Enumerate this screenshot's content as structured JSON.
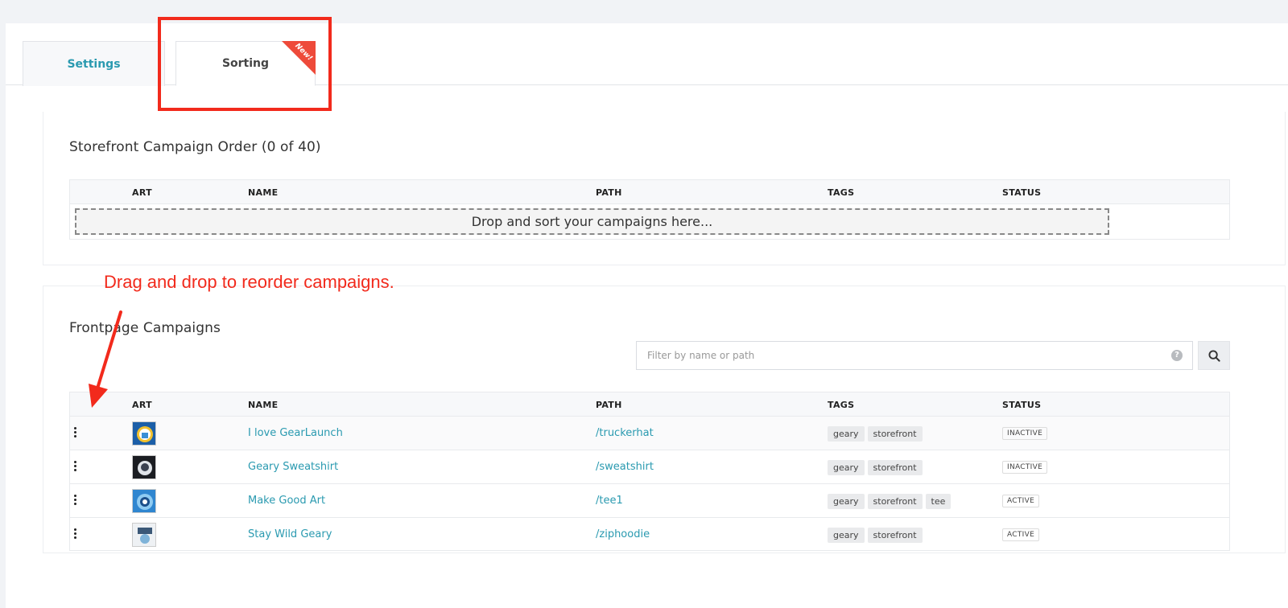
{
  "tabs": [
    {
      "label": "Settings"
    },
    {
      "label": "Sorting",
      "badge": "New!"
    }
  ],
  "storefront": {
    "title": "Storefront Campaign Order (0 of 40)",
    "columns": {
      "art": "ART",
      "name": "NAME",
      "path": "PATH",
      "tags": "TAGS",
      "status": "STATUS"
    },
    "dropzone": "Drop and sort your campaigns here..."
  },
  "annotation": {
    "text": "Drag and drop to reorder campaigns.",
    "color": "#f22a1c"
  },
  "frontpage": {
    "title": "Frontpage Campaigns",
    "search": {
      "placeholder": "Filter by name or path",
      "value": ""
    },
    "columns": {
      "art": "ART",
      "name": "NAME",
      "path": "PATH",
      "tags": "TAGS",
      "status": "STATUS"
    },
    "rows": [
      {
        "name": "I love GearLaunch",
        "path": "/truckerhat",
        "tags": [
          "geary",
          "storefront"
        ],
        "status": "INACTIVE"
      },
      {
        "name": "Geary Sweatshirt",
        "path": "/sweatshirt",
        "tags": [
          "geary",
          "storefront"
        ],
        "status": "INACTIVE"
      },
      {
        "name": "Make Good Art",
        "path": "/tee1",
        "tags": [
          "geary",
          "storefront",
          "tee"
        ],
        "status": "ACTIVE"
      },
      {
        "name": "Stay Wild Geary",
        "path": "/ziphoodie",
        "tags": [
          "geary",
          "storefront"
        ],
        "status": "ACTIVE"
      }
    ]
  },
  "colors": {
    "accent": "#2a9ab0",
    "ribbon": "#ee4a3a",
    "highlight": "#f22a1c"
  },
  "icons": [
    "help-icon",
    "search-icon",
    "drag-handle-icon",
    "new-ribbon"
  ]
}
